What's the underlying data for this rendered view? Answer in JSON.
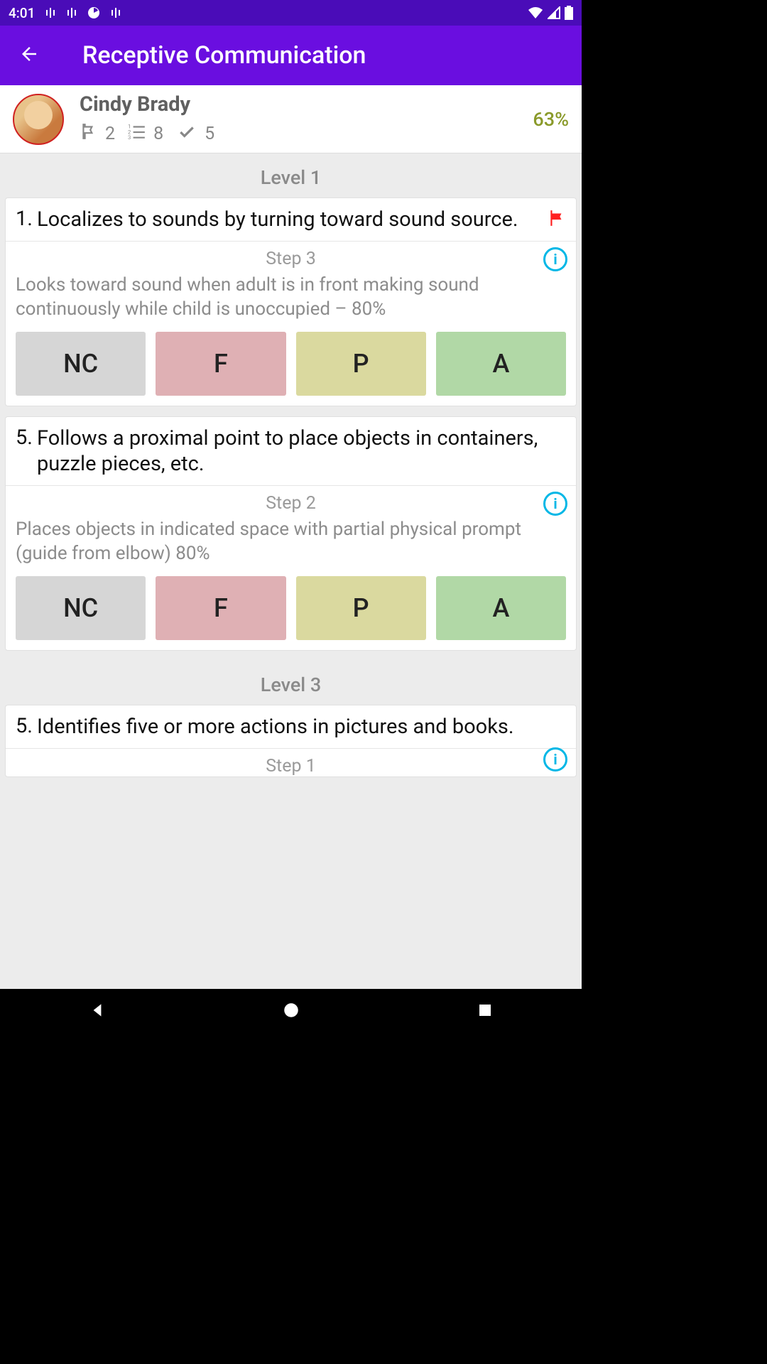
{
  "status": {
    "time": "4:01"
  },
  "appbar": {
    "title": "Receptive Communication"
  },
  "student": {
    "name": "Cindy Brady",
    "flags": "2",
    "steps": "8",
    "checks": "5",
    "percent": "63%"
  },
  "levels": [
    {
      "header": "Level 1",
      "items": [
        {
          "num": "1.",
          "text": "Localizes to sounds by turning toward sound source.",
          "flagged": true,
          "step_label": "Step 3",
          "step_desc": "Looks toward sound when adult is in front making sound continuously while child is unoccupied  – 80%",
          "buttons": {
            "nc": "NC",
            "f": "F",
            "p": "P",
            "a": "A"
          }
        },
        {
          "num": "5.",
          "text": "Follows a proximal point to place objects in containers, puzzle pieces, etc.",
          "flagged": false,
          "step_label": "Step 2",
          "step_desc": "Places objects in indicated space with partial physical prompt (guide from elbow) 80%",
          "buttons": {
            "nc": "NC",
            "f": "F",
            "p": "P",
            "a": "A"
          }
        }
      ]
    },
    {
      "header": "Level 3",
      "items": [
        {
          "num": "5.",
          "text": "Identifies five or more actions in pictures and books.",
          "flagged": false,
          "step_label": "Step 1"
        }
      ]
    }
  ]
}
